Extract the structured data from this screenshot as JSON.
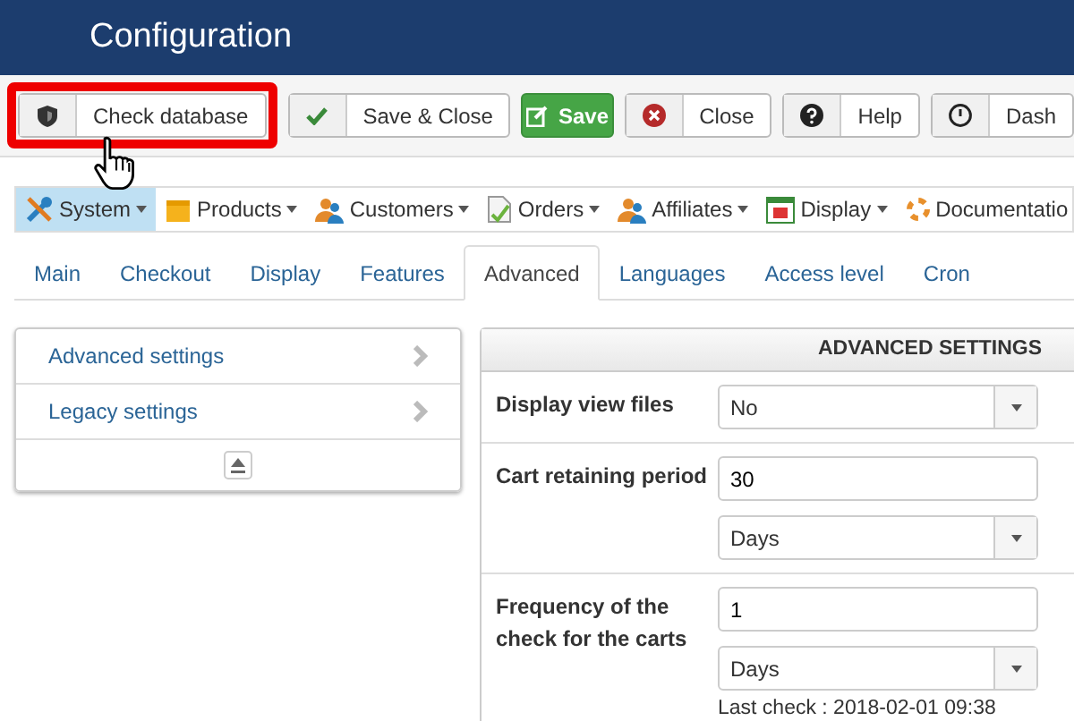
{
  "header": {
    "title": "Configuration"
  },
  "toolbar": [
    {
      "label": "Check database",
      "kind": "default",
      "highlighted": true
    },
    {
      "label": "Save & Close",
      "kind": "default",
      "highlighted": false
    },
    {
      "label": "Save",
      "kind": "success",
      "highlighted": false
    },
    {
      "label": "Close",
      "kind": "default",
      "highlighted": false
    },
    {
      "label": "Help",
      "kind": "default",
      "highlighted": false
    },
    {
      "label": "Dash",
      "kind": "default",
      "highlighted": false
    }
  ],
  "menu": [
    {
      "label": "System",
      "selected": true
    },
    {
      "label": "Products",
      "selected": false
    },
    {
      "label": "Customers",
      "selected": false
    },
    {
      "label": "Orders",
      "selected": false
    },
    {
      "label": "Affiliates",
      "selected": false
    },
    {
      "label": "Display",
      "selected": false
    },
    {
      "label": "Documentatio",
      "selected": false
    }
  ],
  "tabs": [
    {
      "label": "Main",
      "selected": false
    },
    {
      "label": "Checkout",
      "selected": false
    },
    {
      "label": "Display",
      "selected": false
    },
    {
      "label": "Features",
      "selected": false
    },
    {
      "label": "Advanced",
      "selected": true
    },
    {
      "label": "Languages",
      "selected": false
    },
    {
      "label": "Access level",
      "selected": false
    },
    {
      "label": "Cron",
      "selected": false
    }
  ],
  "sidebar": {
    "items": [
      {
        "label": "Advanced settings"
      },
      {
        "label": "Legacy settings"
      }
    ]
  },
  "panel": {
    "title": "ADVANCED SETTINGS",
    "fields": [
      {
        "label": "Display view files",
        "controls": [
          {
            "kind": "select",
            "value": "No"
          }
        ]
      },
      {
        "label": "Cart retaining period",
        "controls": [
          {
            "kind": "input",
            "value": "30"
          },
          {
            "kind": "select",
            "value": "Days"
          }
        ]
      },
      {
        "label": "Frequency of the check for the carts",
        "controls": [
          {
            "kind": "input",
            "value": "1"
          },
          {
            "kind": "select",
            "value": "Days"
          }
        ],
        "note": "Last check : 2018-02-01 09:38"
      }
    ]
  }
}
